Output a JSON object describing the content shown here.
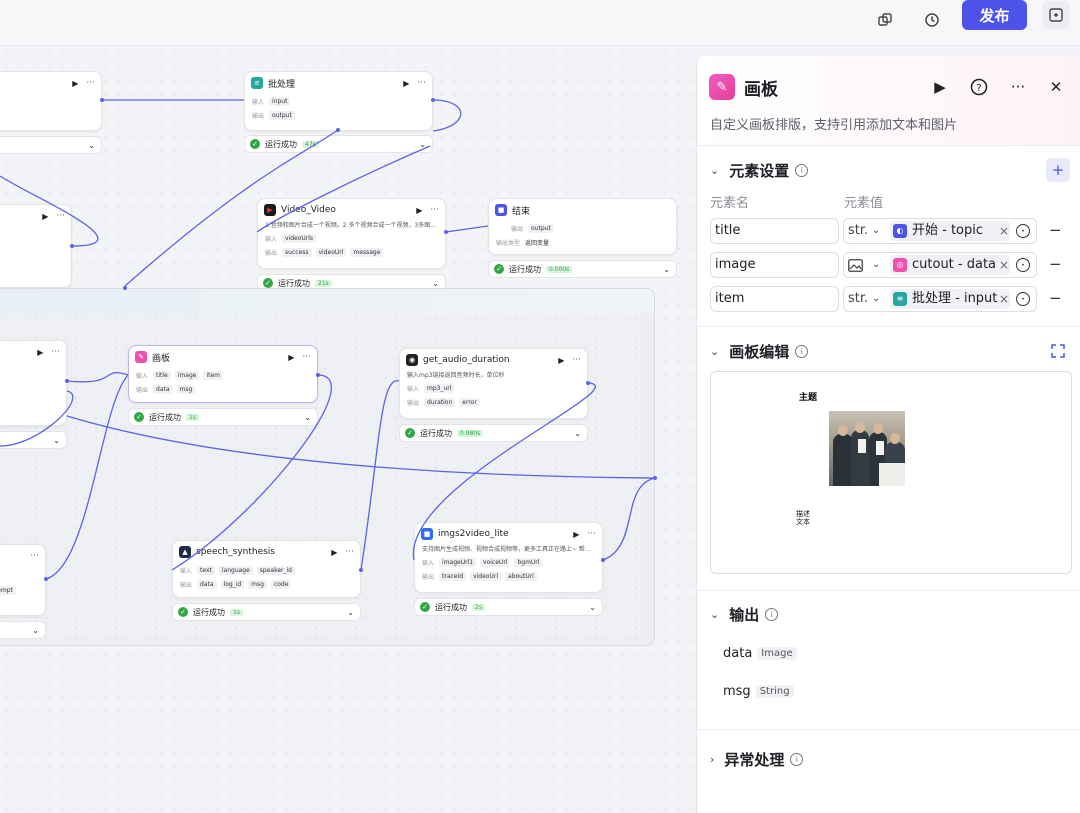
{
  "toolbar": {
    "publish_label": "发布",
    "icons": [
      "duplicate-icon",
      "history-icon",
      "expand-icon"
    ]
  },
  "nodes": {
    "batch": {
      "title": "批处理",
      "in_label": "输入",
      "in_val": "input",
      "out_label": "输出",
      "out_val": "output",
      "status": "运行成功",
      "time": "47s"
    },
    "video": {
      "title": "Video_Video",
      "desc": "1.音频和图片合成一个视频。2.多个视频合成一个视频，3多图...",
      "in_label": "输入",
      "in_val": "videoUrls",
      "out_label": "输出",
      "out_vals": [
        "success",
        "videoUrl",
        "message"
      ],
      "status": "运行成功",
      "time": "21s"
    },
    "end": {
      "title": "结束",
      "out_label": "输出",
      "out_val": "output",
      "type_label": "输出类型",
      "type_val": "返回变量",
      "status": "运行成功",
      "time": "0.000s"
    },
    "canvas": {
      "title": "画板",
      "in_label": "输入",
      "in_vals": [
        "title",
        "image",
        "item"
      ],
      "out_label": "输出",
      "out_vals": [
        "data",
        "msg"
      ],
      "status": "运行成功",
      "time": "1s"
    },
    "audio": {
      "title": "get_audio_duration",
      "desc": "输入mp3链接返回音频时长，单位秒",
      "in_label": "输入",
      "in_val": "mp3_url",
      "out_label": "输出",
      "out_vals": [
        "duration",
        "error"
      ],
      "status": "运行成功",
      "time": "0.980s"
    },
    "speech": {
      "title": "speech_synthesis",
      "in_label": "输入",
      "in_vals": [
        "text",
        "language",
        "speaker_id"
      ],
      "out_label": "输出",
      "out_vals": [
        "data",
        "log_id",
        "msg",
        "code"
      ],
      "status": "运行成功",
      "time": "1s"
    },
    "img2video": {
      "title": "imgs2video_lite",
      "desc": "支持图片生成视频、视频合成视频等，更多工具正在路上~ 帮...",
      "in_label": "输入",
      "in_vals": [
        "imageUrl1",
        "voiceUrl",
        "bgmUrl"
      ],
      "out_label": "输出",
      "out_vals": [
        "traceId",
        "videoUrl",
        "aboutUrl"
      ],
      "status": "运行成功",
      "time": "2s"
    },
    "left_prompt": {
      "in_val": "prompt"
    }
  },
  "panel": {
    "title": "画板",
    "description": "自定义画板排版，支持引用添加文本和图片",
    "elements_section": "元素设置",
    "col_name": "元素名",
    "col_value": "元素值",
    "elements": [
      {
        "name": "title",
        "type": "str.",
        "ref": "开始 - topic",
        "ref_icon_color": "#4d53e8"
      },
      {
        "name": "image",
        "type": "image",
        "ref": "cutout - data",
        "ref_icon_color": "#f04fb0"
      },
      {
        "name": "item",
        "type": "str.",
        "ref": "批处理 - input",
        "ref_icon_color": "#25a6a0"
      }
    ],
    "editor_section": "画板编辑",
    "preview_title": "主题",
    "preview_desc": "描述文本",
    "output_section": "输出",
    "outputs": [
      {
        "name": "data",
        "type": "Image"
      },
      {
        "name": "msg",
        "type": "String"
      }
    ],
    "error_section": "异常处理"
  }
}
